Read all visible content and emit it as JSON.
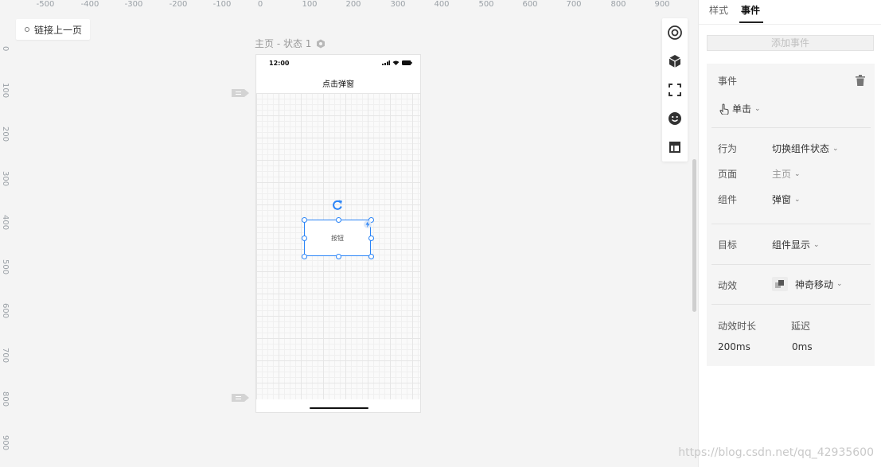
{
  "ruler": {
    "top_ticks": [
      "-500",
      "-400",
      "-300",
      "-200",
      "-100",
      "0",
      "100",
      "200",
      "300",
      "400",
      "500",
      "600",
      "700",
      "800",
      "900"
    ],
    "left_ticks": [
      "0",
      "100",
      "200",
      "300",
      "400",
      "500",
      "600",
      "700",
      "800",
      "900"
    ]
  },
  "canvas": {
    "link_prev_label": "链接上一页",
    "page_state_label": "主页 - 状态 1",
    "phone": {
      "time": "12:00",
      "nav_title": "点击弹窗",
      "button_text": "按钮"
    }
  },
  "toolbar": {
    "icons": [
      "target-icon",
      "cube-icon",
      "scan-frame-icon",
      "smile-icon",
      "layout-icon"
    ]
  },
  "panel": {
    "tabs": {
      "style": "样式",
      "event": "事件"
    },
    "add_event_label": "添加事件",
    "event_section_label": "事件",
    "trigger_value": "单击",
    "action_label": "行为",
    "action_value": "切换组件状态",
    "page_label": "页面",
    "page_value": "主页",
    "component_label": "组件",
    "component_value": "弹窗",
    "target_label": "目标",
    "target_value": "组件显示",
    "effect_label": "动效",
    "effect_value": "神奇移动",
    "duration_label": "动效时长",
    "duration_value": "200ms",
    "delay_label": "延迟",
    "delay_value": "0ms"
  },
  "watermark": "https://blog.csdn.net/qq_42935600",
  "colors": {
    "accent": "#2a84f7",
    "canvas_bg": "#f4f4f4"
  }
}
